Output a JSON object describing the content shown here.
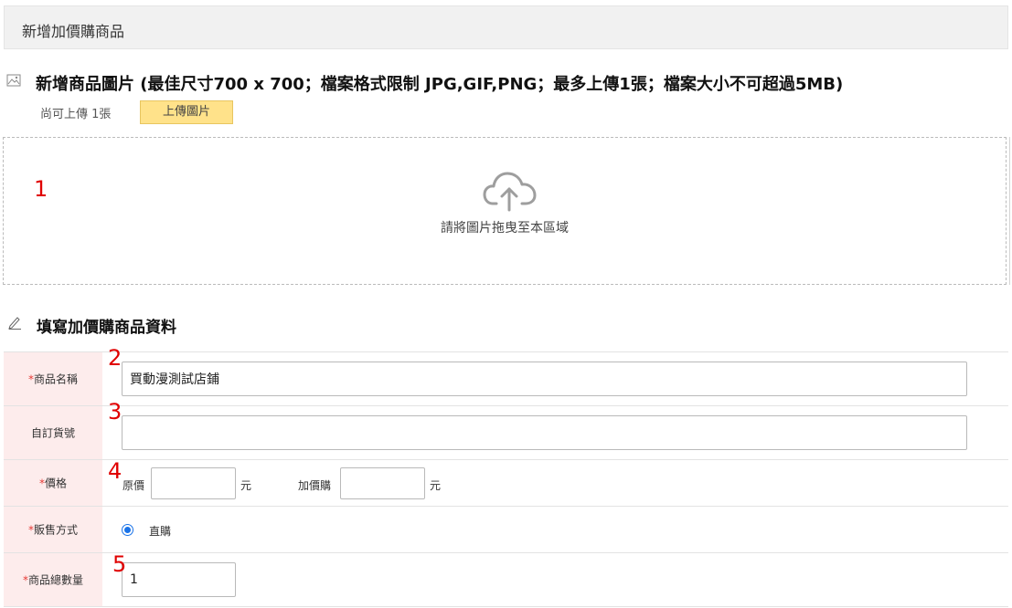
{
  "header": {
    "title": "新增加價購商品"
  },
  "upload": {
    "icon": "image-icon",
    "heading": "新增商品圖片 (最佳尺寸700 x 700；檔案格式限制 JPG,GIF,PNG；最多上傳1張；檔案大小不可超過5MB)",
    "remaining_text": "尚可上傳 1張",
    "button_label": "上傳圖片",
    "dropzone_icon": "cloud-upload-icon",
    "dropzone_text": "請將圖片拖曳至本區域"
  },
  "form": {
    "icon": "pencil-icon",
    "heading": "填寫加價購商品資料",
    "required_mark": "*",
    "fields": {
      "name": {
        "label": "商品名稱",
        "value": "買動漫測試店鋪"
      },
      "sku": {
        "label": "自訂貨號",
        "value": ""
      },
      "price": {
        "label": "價格",
        "original_label": "原價",
        "original_value": "",
        "addon_label": "加價購",
        "addon_value": "",
        "unit": "元"
      },
      "sale_method": {
        "label": "販售方式",
        "option": "直購",
        "selected": true
      },
      "quantity": {
        "label": "商品總數量",
        "value": "1"
      }
    }
  },
  "markers": [
    "1",
    "2",
    "3",
    "4",
    "5"
  ],
  "colors": {
    "required": "#e53935",
    "label_bg": "#fdecec",
    "upload_button": "#ffe28a",
    "radio": "#1a73e8",
    "marker": "#e00000"
  }
}
